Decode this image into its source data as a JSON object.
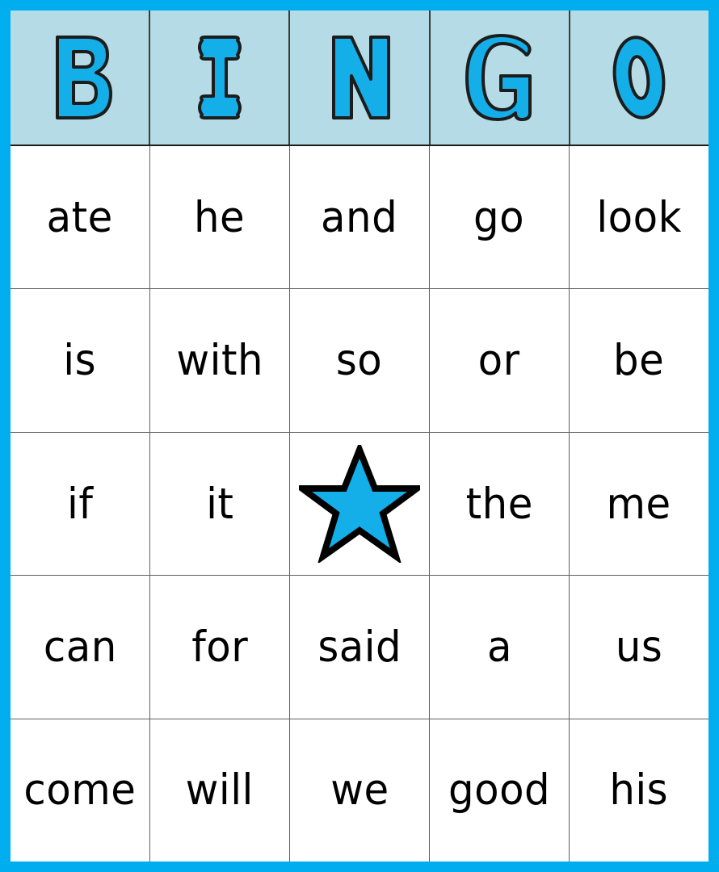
{
  "card": {
    "title": "BINGO",
    "frame_color": "#00AEEF",
    "header_background": "#B5DCE6",
    "letter_fill": "#14AEE8",
    "letter_outline": "#1c1c1c",
    "cell_background": "#ffffff",
    "grid_line_color": "#5f5f5f",
    "word_color": "#000000"
  },
  "header": {
    "letters": [
      {
        "label": "B",
        "name": "bingo-letter-b"
      },
      {
        "label": "I",
        "name": "bingo-letter-i"
      },
      {
        "label": "N",
        "name": "bingo-letter-n"
      },
      {
        "label": "G",
        "name": "bingo-letter-g"
      },
      {
        "label": "O",
        "name": "bingo-letter-o"
      }
    ]
  },
  "grid": {
    "columns": 5,
    "rows": 5,
    "free_space": {
      "row": 2,
      "column": 2,
      "icon": "star-icon",
      "label": ""
    },
    "cells": [
      [
        {
          "word": "ate"
        },
        {
          "word": "he"
        },
        {
          "word": "and"
        },
        {
          "word": "go"
        },
        {
          "word": "look"
        }
      ],
      [
        {
          "word": "is"
        },
        {
          "word": "with"
        },
        {
          "word": "so"
        },
        {
          "word": "or"
        },
        {
          "word": "be"
        }
      ],
      [
        {
          "word": "if"
        },
        {
          "word": "it"
        },
        {
          "word": ""
        },
        {
          "word": "the"
        },
        {
          "word": "me"
        }
      ],
      [
        {
          "word": "can"
        },
        {
          "word": "for"
        },
        {
          "word": "said"
        },
        {
          "word": "a"
        },
        {
          "word": "us"
        }
      ],
      [
        {
          "word": "come"
        },
        {
          "word": "will"
        },
        {
          "word": "we"
        },
        {
          "word": "good"
        },
        {
          "word": "his"
        }
      ]
    ]
  }
}
